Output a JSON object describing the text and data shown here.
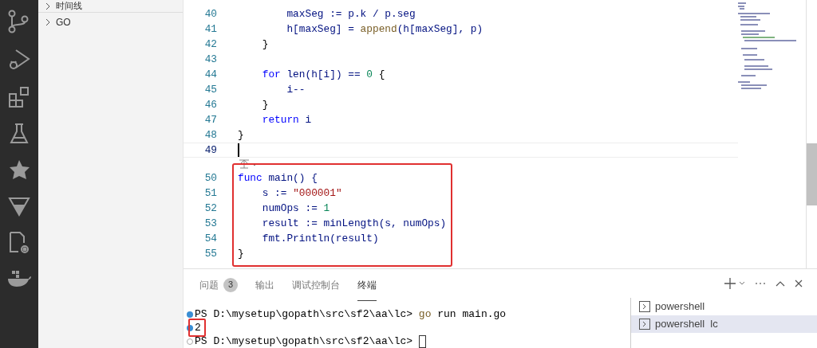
{
  "sidebar": {
    "sections": [
      {
        "label": "时间线",
        "expanded": false
      },
      {
        "label": "GO",
        "expanded": false
      }
    ]
  },
  "editor": {
    "lines": [
      {
        "number": "40",
        "current": false,
        "boxed": false,
        "tokens": [
          {
            "text": "        maxSeg := p.k / p.seg",
            "kind": "var"
          }
        ]
      },
      {
        "number": "41",
        "current": false,
        "boxed": false,
        "tokens": [
          {
            "text": "        h[maxSeg] = ",
            "kind": "var"
          },
          {
            "text": "append",
            "kind": "fn"
          },
          {
            "text": "(h[maxSeg], p)",
            "kind": "var"
          }
        ]
      },
      {
        "number": "42",
        "current": false,
        "boxed": false,
        "tokens": [
          {
            "text": "    }",
            "kind": "plain"
          }
        ]
      },
      {
        "number": "43",
        "current": false,
        "boxed": false
      },
      {
        "number": "44",
        "current": false,
        "boxed": false,
        "tokens": [
          {
            "text": "    for",
            "kind": "kw"
          },
          {
            "text": " len(h[i]) == ",
            "kind": "var"
          },
          {
            "text": "0",
            "kind": "num"
          },
          {
            "text": " {",
            "kind": "plain"
          }
        ]
      },
      {
        "number": "45",
        "current": false,
        "boxed": false,
        "tokens": [
          {
            "text": "        i--",
            "kind": "var"
          }
        ]
      },
      {
        "number": "46",
        "current": false,
        "boxed": false,
        "tokens": [
          {
            "text": "    }",
            "kind": "plain"
          }
        ]
      },
      {
        "number": "47",
        "current": false,
        "boxed": false,
        "tokens": [
          {
            "text": "    return",
            "kind": "kw"
          },
          {
            "text": " i",
            "kind": "var"
          }
        ]
      },
      {
        "number": "48",
        "current": false,
        "boxed": false,
        "tokens": [
          {
            "text": "}",
            "kind": "plain"
          }
        ]
      },
      {
        "number": "49",
        "current": true,
        "boxed": false,
        "codelens": true
      },
      {
        "number": "50",
        "current": false,
        "boxed": true,
        "tokens": [
          {
            "text": "func",
            "kind": "kw"
          },
          {
            "text": " main() {",
            "kind": "var"
          }
        ]
      },
      {
        "number": "51",
        "current": false,
        "boxed": true,
        "tokens": [
          {
            "text": "    s := ",
            "kind": "var"
          },
          {
            "text": "\"000001\"",
            "kind": "str"
          }
        ]
      },
      {
        "number": "52",
        "current": false,
        "boxed": true,
        "tokens": [
          {
            "text": "    numOps := ",
            "kind": "var"
          },
          {
            "text": "1",
            "kind": "num"
          }
        ]
      },
      {
        "number": "53",
        "current": false,
        "boxed": true,
        "tokens": [
          {
            "text": "    result := minLength(s, numOps)",
            "kind": "var"
          }
        ]
      },
      {
        "number": "54",
        "current": false,
        "boxed": true,
        "tokens": [
          {
            "text": "    fmt.Println(result)",
            "kind": "var"
          }
        ]
      },
      {
        "number": "55",
        "current": false,
        "boxed": true,
        "tokens": [
          {
            "text": "}",
            "kind": "plain"
          }
        ]
      }
    ]
  },
  "panel": {
    "tabs": [
      {
        "label": "问题",
        "badge": "3",
        "selected": false
      },
      {
        "label": "输出",
        "selected": false
      },
      {
        "label": "调试控制台",
        "selected": false
      },
      {
        "label": "终端",
        "selected": true
      }
    ],
    "terminal_lines": [
      {
        "kind": "filled",
        "boxed": false,
        "cursor": false,
        "tokens": [
          {
            "text": "PS D:\\mysetup\\gopath\\src\\sf2\\aa\\lc> ",
            "kind": "plain"
          },
          {
            "text": "go",
            "kind": "cmd"
          },
          {
            "text": " run main.go",
            "kind": "plain"
          }
        ]
      },
      {
        "kind": "filled",
        "boxed": true,
        "cursor": false,
        "tokens": [
          {
            "text": "2",
            "kind": "plain"
          }
        ]
      },
      {
        "kind": "hollow",
        "boxed": false,
        "cursor": true,
        "tokens": [
          {
            "text": "PS D:\\mysetup\\gopath\\src\\sf2\\aa\\lc> ",
            "kind": "plain"
          }
        ]
      }
    ],
    "terminals": [
      {
        "label": "powershell",
        "selected": false
      },
      {
        "label": "powershell  lc",
        "selected": true
      }
    ]
  }
}
